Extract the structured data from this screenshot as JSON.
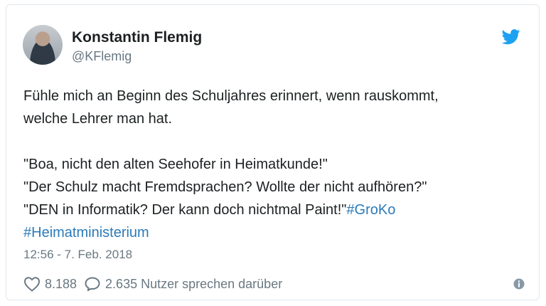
{
  "tweet": {
    "author": {
      "name": "Konstantin Flemig",
      "handle": "@KFlemig"
    },
    "body": {
      "line1": "Fühle mich an Beginn des Schuljahres erinnert, wenn rauskommt,",
      "line2": "welche Lehrer man hat.",
      "quote1": "\"Boa, nicht den alten Seehofer in Heimatkunde!\"",
      "quote2": "\"Der Schulz macht Fremdsprachen? Wollte der nicht aufhören?\"",
      "quote3": "\"DEN in Informatik? Der kann doch nichtmal Paint!\"",
      "hashtag1": "#GroKo",
      "hashtag2": "#Heimatministerium"
    },
    "timestamp": "12:56 - 7. Feb. 2018",
    "likes": "8.188",
    "replies_text": "2.635 Nutzer sprechen darüber"
  },
  "icons": {
    "brand": "twitter-bird-icon",
    "like": "heart-icon",
    "reply": "speech-bubble-icon",
    "info": "info-icon"
  },
  "colors": {
    "text": "#1c2022",
    "muted": "#697882",
    "link": "#2b7bb9",
    "brand": "#1da1f2",
    "border": "#e1e8ed"
  }
}
